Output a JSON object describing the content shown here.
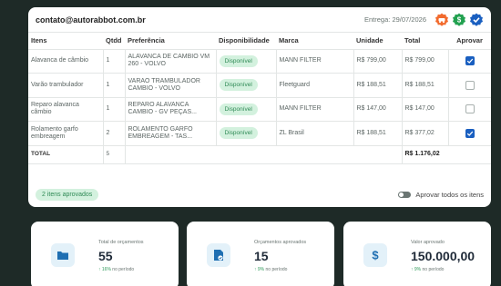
{
  "header": {
    "email": "contato@autorabbot.com.br",
    "entrega_label": "Entrega:",
    "entrega_date": "29/07/2026"
  },
  "table": {
    "columns": [
      "Itens",
      "Qtdd",
      "Preferência",
      "Disponibilidade",
      "Marca",
      "Unidade",
      "Total",
      "Aprovar"
    ],
    "rows": [
      {
        "item": "Alavanca de câmbio",
        "qtd": "1",
        "pref": "ALAVANCA DE CAMBIO VM 260 - VOLVO",
        "disp": "Disponível",
        "marca": "MANN FILTER",
        "unidade": "R$ 799,00",
        "total": "R$ 799,00",
        "approved": true
      },
      {
        "item": "Varão trambulador",
        "qtd": "1",
        "pref": "VARAO TRAMBULADOR CAMBIO - VOLVO",
        "disp": "Disponível",
        "marca": "Fleetguard",
        "unidade": "R$ 188,51",
        "total": "R$ 188,51",
        "approved": false
      },
      {
        "item": "Reparo alavanca câmbio",
        "qtd": "1",
        "pref": "REPARO ALAVANCA CAMBIO - GV PEÇAS...",
        "disp": "Disponível",
        "marca": "MANN FILTER",
        "unidade": "R$ 147,00",
        "total": "R$ 147,00",
        "approved": false
      },
      {
        "item": "Rolamento garfo embreagem",
        "qtd": "2",
        "pref": "ROLAMENTO GARFO EMBREAGEM - TAS...",
        "disp": "Disponível",
        "marca": "ZL Brasil",
        "unidade": "R$ 188,51",
        "total": "R$ 377,02",
        "approved": true
      }
    ],
    "total_label": "TOTAL",
    "total_qtd": "5",
    "total_value": "R$ 1.176,02"
  },
  "footer": {
    "approved_count": "2 itens aprovados",
    "approve_all_label": "Aprovar todos os itens"
  },
  "stats": [
    {
      "label": "Total de orçamentos",
      "value": "55",
      "trend_pct": "16%",
      "trend_suffix": "no período",
      "icon": "folder-icon"
    },
    {
      "label": "Orçamentos aprovados",
      "value": "15",
      "trend_pct": "9%",
      "trend_suffix": "no período",
      "icon": "document-check-icon"
    },
    {
      "label": "Valor aprovado",
      "value": "150.000,00",
      "trend_pct": "9%",
      "trend_suffix": "no período",
      "icon": "dollar-icon"
    }
  ],
  "colors": {
    "background": "#1e2a27",
    "accent_blue": "#1a5fc0",
    "success_green": "#2f8a55",
    "badge_orange": "#f26b2e",
    "badge_green": "#22a150",
    "badge_blue": "#1a5fc0"
  }
}
